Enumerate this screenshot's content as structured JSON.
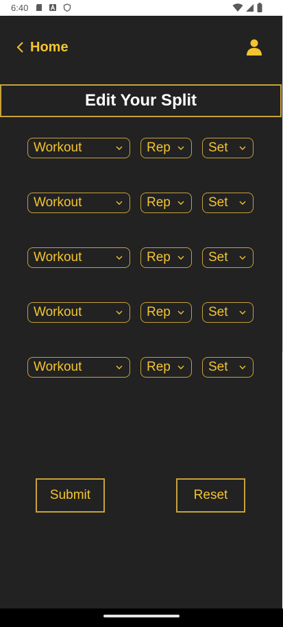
{
  "status_bar": {
    "time": "6:40",
    "left_icons": [
      "sd-card-icon",
      "text-a-icon",
      "shield-icon"
    ],
    "right_icons": [
      "wifi-icon",
      "cellular-icon",
      "battery-icon"
    ]
  },
  "header": {
    "back_label": "Home",
    "profile_icon": "person-icon"
  },
  "page": {
    "title": "Edit Your Split"
  },
  "rows": [
    {
      "workout": "Workout",
      "rep": "Rep",
      "set": "Set"
    },
    {
      "workout": "Workout",
      "rep": "Rep",
      "set": "Set"
    },
    {
      "workout": "Workout",
      "rep": "Rep",
      "set": "Set"
    },
    {
      "workout": "Workout",
      "rep": "Rep",
      "set": "Set"
    },
    {
      "workout": "Workout",
      "rep": "Rep",
      "set": "Set"
    }
  ],
  "actions": {
    "submit_label": "Submit",
    "reset_label": "Reset"
  },
  "colors": {
    "background": "#222222",
    "accent": "#f4c430",
    "border": "#c9a23a",
    "title": "#ffffff"
  }
}
